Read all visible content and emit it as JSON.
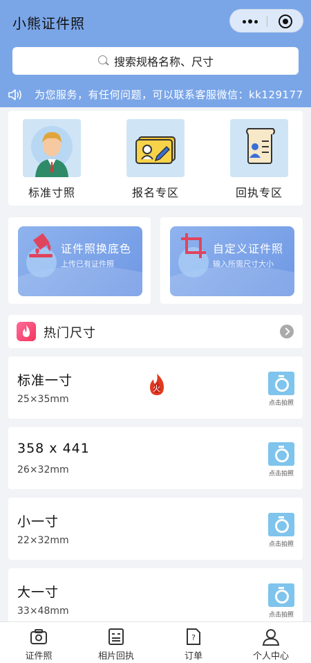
{
  "app": {
    "title": "小熊证件照"
  },
  "capsule": {
    "more_icon": "more-dots-icon",
    "close_icon": "target-circle-icon"
  },
  "search": {
    "placeholder": "搜索规格名称、尺寸",
    "icon": "search-icon"
  },
  "notice": {
    "icon": "speaker-icon",
    "text": "为您服务，有任何问题，可以联系客服微信：kk129177"
  },
  "categories": [
    {
      "label": "标准寸照",
      "icon": "person-portrait-icon"
    },
    {
      "label": "报名专区",
      "icon": "id-card-icon"
    },
    {
      "label": "回执专区",
      "icon": "receipt-document-icon"
    }
  ],
  "features": [
    {
      "title": "证件照换底色",
      "subtitle": "上传已有证件照",
      "icon": "paint-bucket-icon"
    },
    {
      "title": "自定义证件照",
      "subtitle": "输入所需尺寸大小",
      "icon": "crop-icon"
    }
  ],
  "hot": {
    "title": "热门尺寸",
    "icon": "flame-icon",
    "more_icon": "chevron-right-icon"
  },
  "sizes": [
    {
      "name": "标准一寸",
      "dims": "25×35mm",
      "action": "点击拍照",
      "hot_badge": "火"
    },
    {
      "name": "358 x 441",
      "dims": "26×32mm",
      "action": "点击拍照"
    },
    {
      "name": "小一寸",
      "dims": "22×32mm",
      "action": "点击拍照"
    },
    {
      "name": "大一寸",
      "dims": "33×48mm",
      "action": "点击拍照"
    }
  ],
  "tabs": [
    {
      "label": "证件照",
      "icon": "camera-icon"
    },
    {
      "label": "相片回执",
      "icon": "receipt-icon"
    },
    {
      "label": "订单",
      "icon": "order-doc-icon"
    },
    {
      "label": "个人中心",
      "icon": "user-icon"
    }
  ],
  "colors": {
    "header_bg": "#7aa6e8",
    "feature_bg": "#7ba2e8",
    "camera": "#7fc4ec",
    "hot": "#f3365c"
  }
}
